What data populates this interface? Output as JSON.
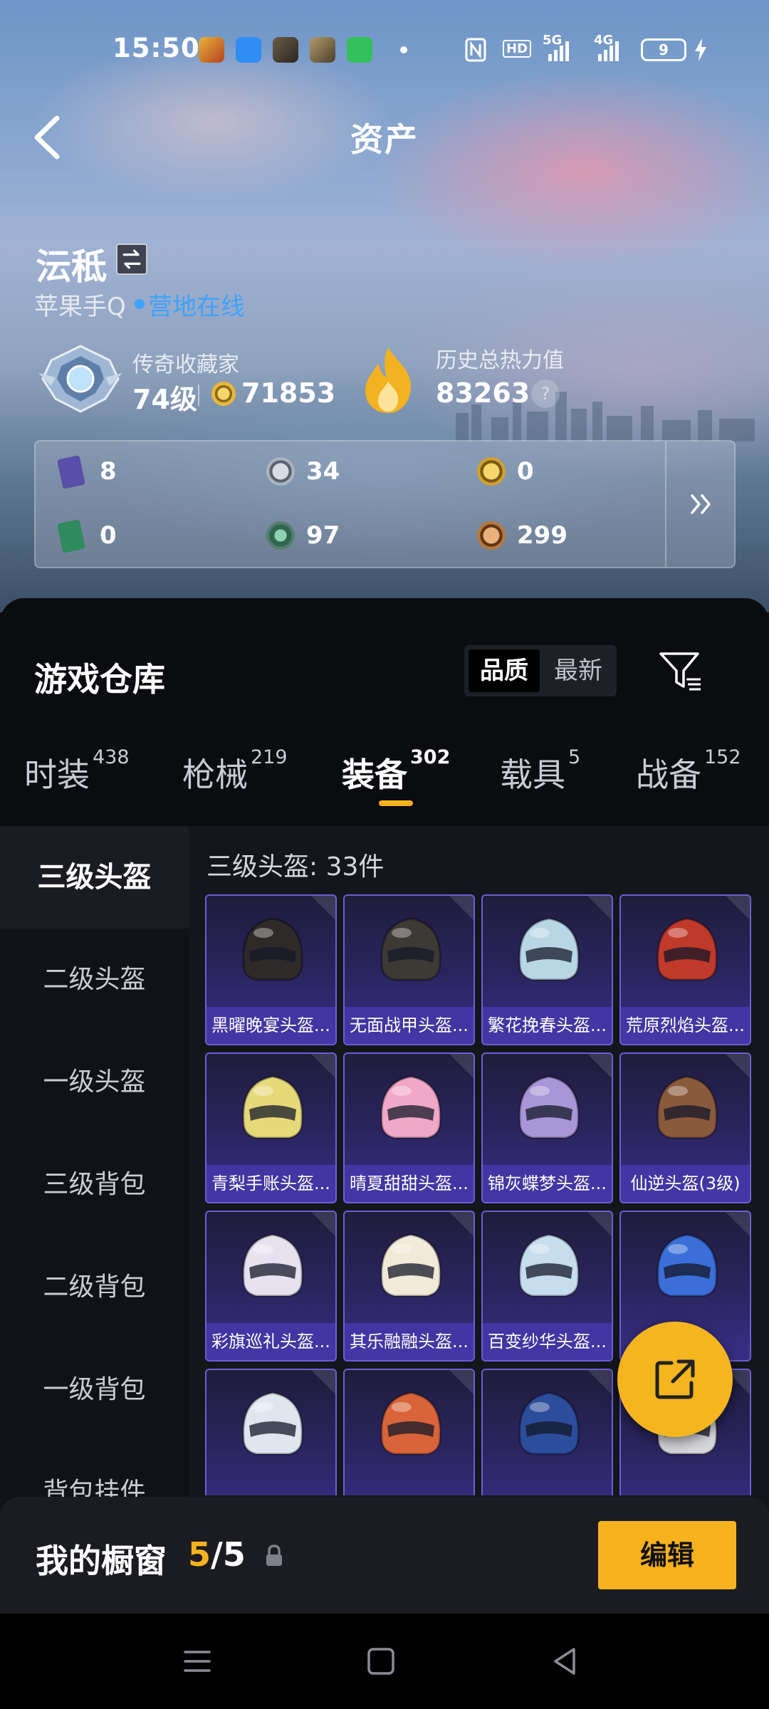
{
  "status_bar": {
    "time": "15:50",
    "network_5g": "5G",
    "network_4g": "4G",
    "hd": "HD",
    "battery": "9"
  },
  "header": {
    "title": "资产",
    "back_icon": "chevron-left-icon"
  },
  "profile": {
    "name": "沄秪",
    "platform": "苹果手Q",
    "online_status": "营地在线",
    "collector_label": "传奇收藏家",
    "level": "74级",
    "coins": "71853",
    "heat_label": "历史总热力值",
    "heat_value": "83263",
    "help": "?"
  },
  "assets": [
    {
      "icon": "purple-card-icon",
      "value": "8",
      "color": "#6b5fb8"
    },
    {
      "icon": "silver-coin-icon",
      "value": "34",
      "color": "#9aa3b0"
    },
    {
      "icon": "gold-coin-icon",
      "value": "0",
      "color": "#d2a22a"
    },
    {
      "icon": "green-card-icon",
      "value": "0",
      "color": "#3a9a6a"
    },
    {
      "icon": "green-orb-icon",
      "value": "97",
      "color": "#4f8c73"
    },
    {
      "icon": "bronze-coin-icon",
      "value": "299",
      "color": "#b8783a"
    }
  ],
  "warehouse": {
    "title": "游戏仓库",
    "sort_active": "品质",
    "sort_other": "最新",
    "tabs": [
      {
        "label": "时装",
        "count": "438"
      },
      {
        "label": "枪械",
        "count": "219"
      },
      {
        "label": "装备",
        "count": "302"
      },
      {
        "label": "载具",
        "count": "5"
      },
      {
        "label": "战备",
        "count": "152"
      }
    ],
    "sidebar": [
      "三级头盔",
      "二级头盔",
      "一级头盔",
      "三级背包",
      "二级背包",
      "一级背包",
      "背包挂件"
    ],
    "count_label": "三级头盔: 33件",
    "items": [
      {
        "name": "黑曜晚宴头盔...",
        "color": "#2e2a2a"
      },
      {
        "name": "无面战甲头盔...",
        "color": "#3d3a36"
      },
      {
        "name": "繁花挽春头盔...",
        "color": "#b9d6e6"
      },
      {
        "name": "荒原烈焰头盔...",
        "color": "#c0392b"
      },
      {
        "name": "青梨手账头盔...",
        "color": "#e6d97a"
      },
      {
        "name": "晴夏甜甜头盔...",
        "color": "#f1a7c8"
      },
      {
        "name": "锦灰蝶梦头盔...",
        "color": "#a996d8"
      },
      {
        "name": "仙逆头盔(3级)",
        "color": "#8a5a3c"
      },
      {
        "name": "彩旗巡礼头盔...",
        "color": "#e6e2f0"
      },
      {
        "name": "其乐融融头盔...",
        "color": "#f2ead8"
      },
      {
        "name": "百变纱华头盔...",
        "color": "#c6dcef"
      },
      {
        "name": "",
        "color": "#3b6ed8"
      },
      {
        "name": "",
        "color": "#dfe6f0"
      },
      {
        "name": "",
        "color": "#d9643a"
      },
      {
        "name": "",
        "color": "#2c4d9c"
      },
      {
        "name": "",
        "color": "#d7d7dc"
      }
    ]
  },
  "showcase": {
    "title": "我的橱窗",
    "current": "5",
    "separator": "/",
    "total": "5",
    "edit_label": "编辑"
  }
}
